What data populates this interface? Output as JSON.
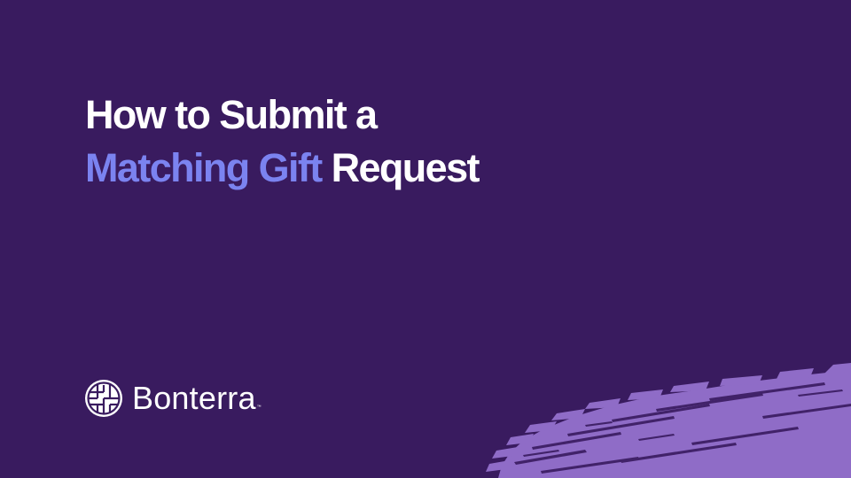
{
  "slide": {
    "title_line1": "How to Submit a",
    "title_highlight": "Matching Gift",
    "title_line2_rest": " Request"
  },
  "brand": {
    "logo_icon": "bonterra-woven-icon",
    "name": "Bonterra",
    "trademark": "™"
  },
  "colors": {
    "background": "#391b5f",
    "accent": "#7b83f0",
    "text": "#ffffff",
    "brush": "#8f6cc7"
  }
}
